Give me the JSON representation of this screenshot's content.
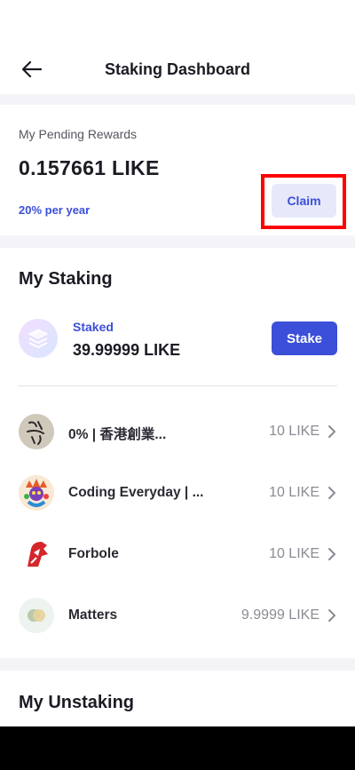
{
  "header": {
    "title": "Staking Dashboard",
    "back_icon": "arrow-left-icon"
  },
  "rewards": {
    "label": "My Pending Rewards",
    "amount": "0.157661 LIKE",
    "apr": "20% per year",
    "claim_label": "Claim"
  },
  "staking": {
    "title": "My Staking",
    "staked_label": "Staked",
    "staked_amount": "39.99999 LIKE",
    "stake_label": "Stake",
    "validators": [
      {
        "name": "0% | 香港創業...",
        "value": "10 LIKE",
        "icon": "calligraphy-avatar"
      },
      {
        "name": "Coding Everyday | ...",
        "value": "10 LIKE",
        "icon": "character-avatar"
      },
      {
        "name": "Forbole",
        "value": "10 LIKE",
        "icon": "forbole-logo"
      },
      {
        "name": "Matters",
        "value": "9.9999 LIKE",
        "icon": "matters-logo"
      }
    ]
  },
  "unstaking": {
    "title": "My Unstaking"
  },
  "colors": {
    "accent": "#3b4fd8",
    "accent_light": "#e7e9fb",
    "highlight": "#ff0000"
  }
}
